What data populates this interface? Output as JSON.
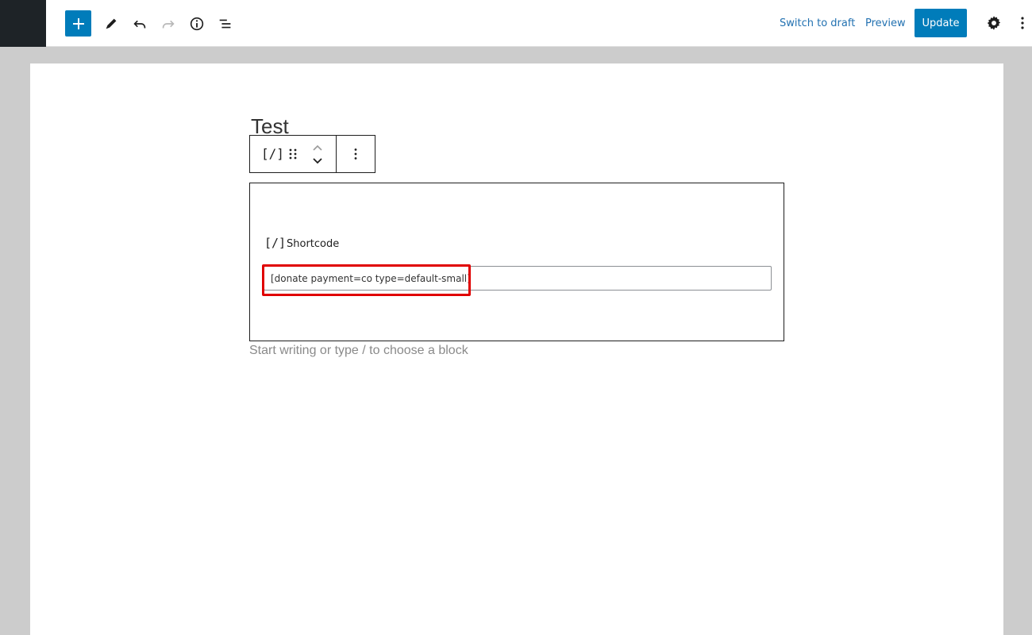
{
  "topbar": {
    "inserter_icon": "plus-icon",
    "tools": [
      "pencil-icon",
      "undo-icon",
      "redo-icon",
      "info-icon",
      "list-view-icon"
    ],
    "switch_to_draft": "Switch to draft",
    "preview": "Preview",
    "update": "Update",
    "accent_color": "#007cba",
    "link_color": "#2271b1"
  },
  "editor": {
    "post_title": "Test",
    "block_toolbar": {
      "block_icon": "[/]",
      "drag_icon": "drag-handle-icon",
      "mover_icon": "up-down-chevron-icon",
      "options_icon": "vertical-ellipsis-icon"
    },
    "shortcode_block": {
      "icon": "[/]",
      "label": "Shortcode",
      "value": "[donate payment=co type=default-small]"
    },
    "highlight_color": "#e00000",
    "placeholder": "Start writing or type / to choose a block"
  }
}
